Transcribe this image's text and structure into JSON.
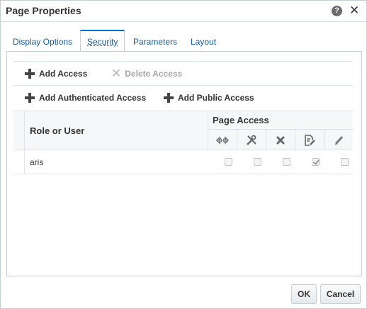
{
  "dialog": {
    "title": "Page Properties",
    "help_glyph": "?",
    "close_glyph": "✕"
  },
  "tabs": [
    {
      "label": "Display Options",
      "active": false
    },
    {
      "label": "Security",
      "active": true
    },
    {
      "label": "Parameters",
      "active": false
    },
    {
      "label": "Layout",
      "active": false
    }
  ],
  "toolbar": {
    "add_access": "Add Access",
    "delete_access": "Delete Access",
    "add_authenticated_access": "Add Authenticated Access",
    "add_public_access": "Add Public Access"
  },
  "grid": {
    "col_role": "Role or User",
    "col_page_access": "Page Access",
    "access_icons": [
      "view-icon",
      "customize-icon",
      "delete-icon",
      "update-icon",
      "edit-icon"
    ],
    "rows": [
      {
        "name": "aris",
        "checks": [
          false,
          false,
          false,
          true,
          false
        ]
      }
    ]
  },
  "buttons": {
    "ok": "OK",
    "cancel": "Cancel"
  },
  "colors": {
    "accent": "#0572ce",
    "link": "#145c9e"
  }
}
